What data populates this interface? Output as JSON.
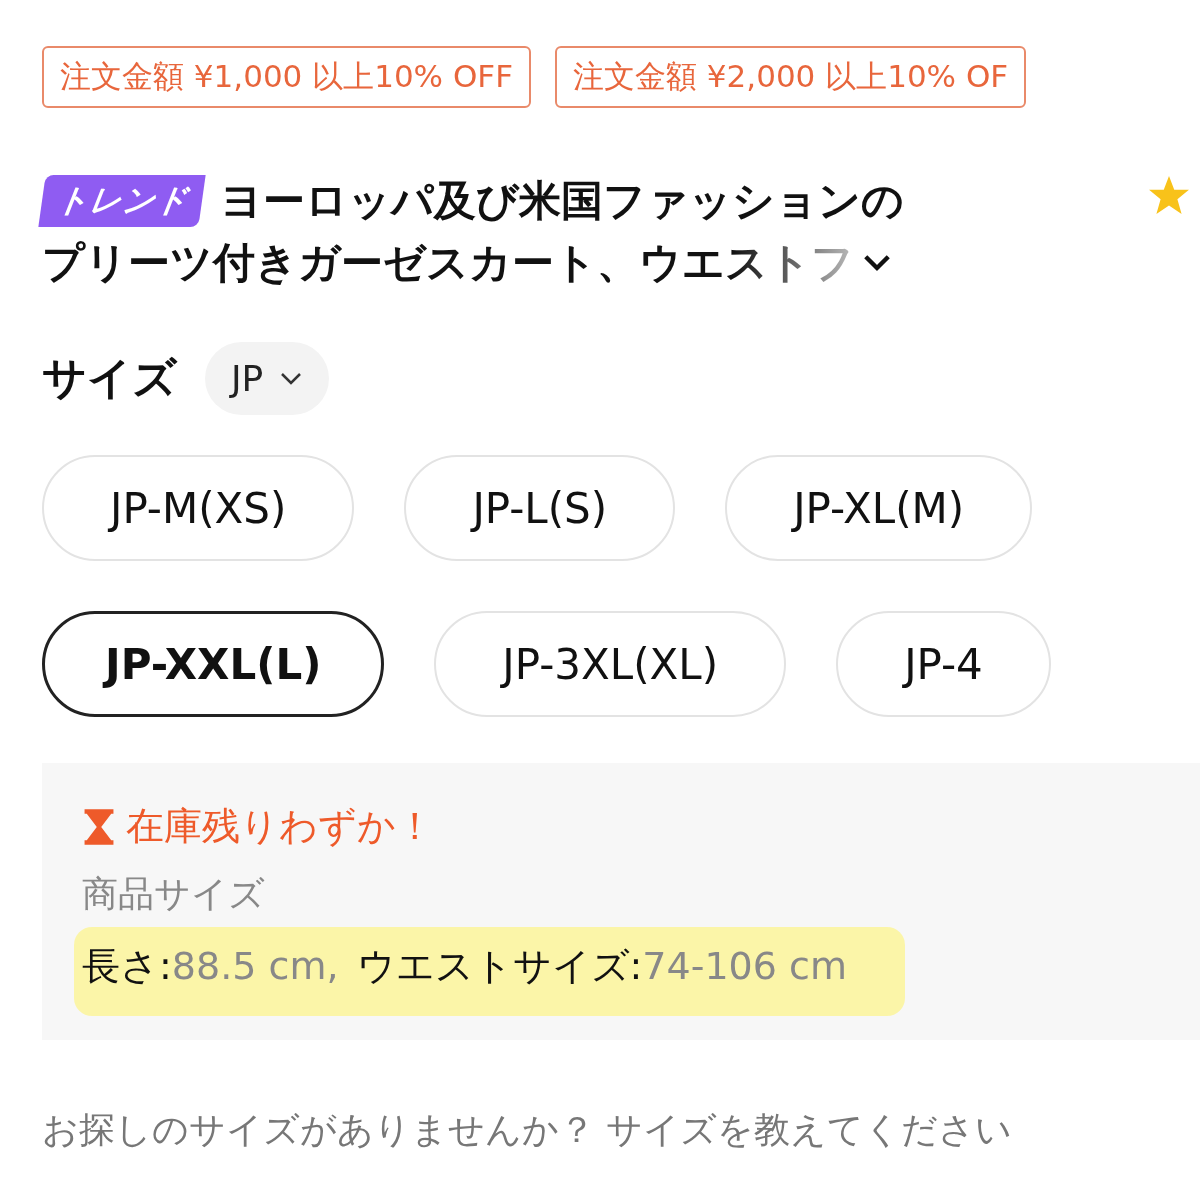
{
  "coupons": [
    "注文金額 ¥1,000 以上10% OFF",
    "注文金額 ¥2,000 以上10% OF"
  ],
  "product": {
    "badge": "トレンド",
    "title_lines": [
      "ヨーロッパ及び米国ファッションの",
      "プリーツ付きガーゼスカート、ウエストフ"
    ]
  },
  "size": {
    "label": "サイズ",
    "region": "JP",
    "option_rows": [
      [
        {
          "label": "JP-M(XS)",
          "selected": false
        },
        {
          "label": "JP-L(S)",
          "selected": false
        },
        {
          "label": "JP-XL(M)",
          "selected": false
        }
      ],
      [
        {
          "label": "JP-XXL(L)",
          "selected": true
        },
        {
          "label": "JP-3XL(XL)",
          "selected": false
        },
        {
          "label": "JP-4",
          "selected": false
        }
      ]
    ]
  },
  "stock": {
    "warning": "在庫残りわずか！",
    "heading": "商品サイズ",
    "measurements": [
      {
        "label": "長さ:",
        "value": "88.5 cm,"
      },
      {
        "label": "ウエストサイズ:",
        "value": "74-106 cm"
      }
    ]
  },
  "prompt": "お探しのサイズがありませんか？ サイズを教えてください"
}
